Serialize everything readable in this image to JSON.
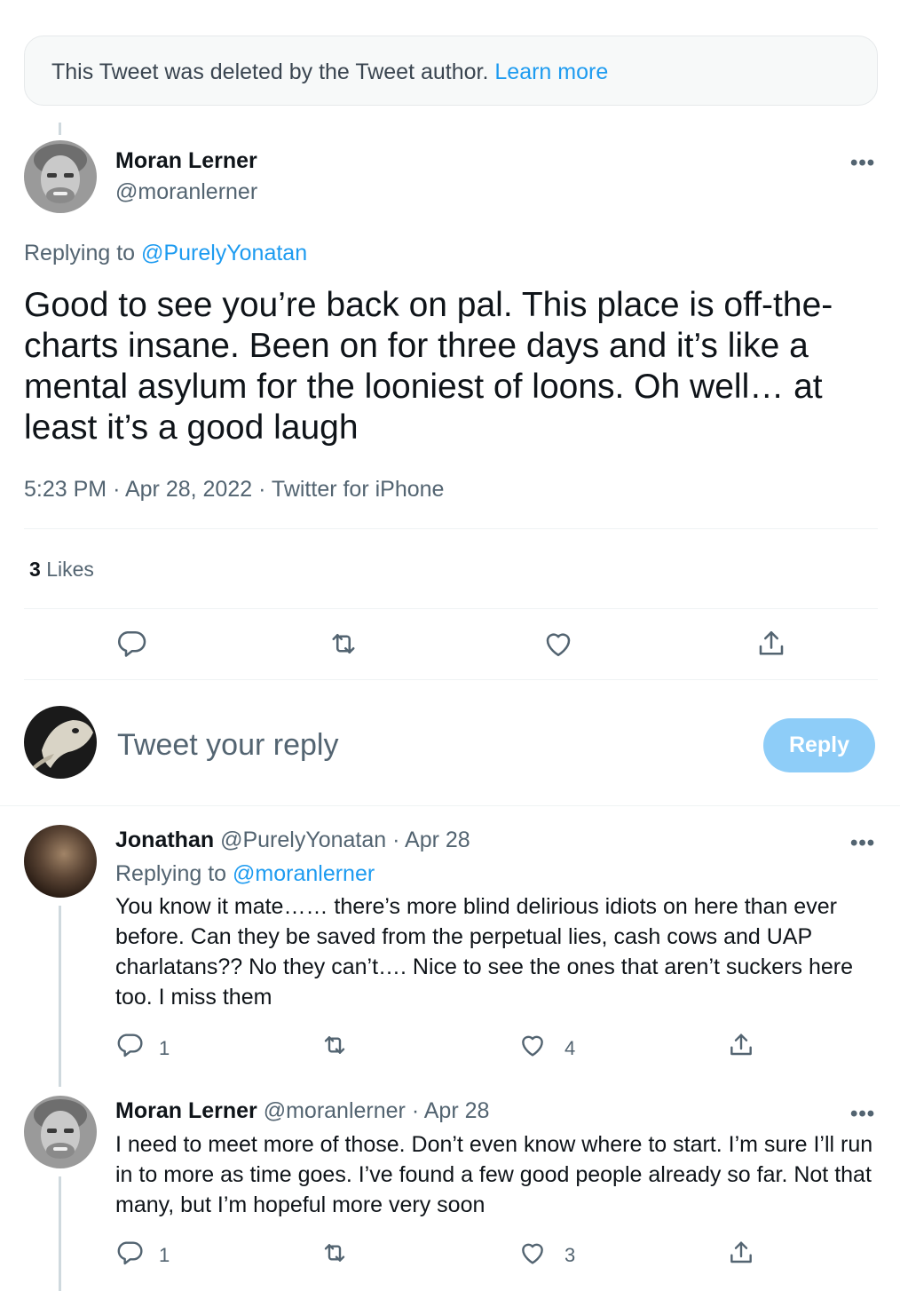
{
  "deleted_notice": {
    "text": "This Tweet was deleted by the Tweet author.",
    "link": "Learn more"
  },
  "main_tweet": {
    "name": "Moran Lerner",
    "handle": "@moranlerner",
    "replying_prefix": "Replying to",
    "replying_to": "@PurelyYonatan",
    "text": "Good to see you’re back on pal. This place is off-the-charts insane. Been on for three days and it’s like a mental asylum for the looniest of loons. Oh well… at least it’s a good laugh",
    "time": "5:23 PM",
    "date": "Apr 28, 2022",
    "source": "Twitter for iPhone",
    "sep": "·",
    "likes_count": "3",
    "likes_label": "Likes",
    "more": "•••"
  },
  "composer": {
    "placeholder": "Tweet your reply",
    "button": "Reply"
  },
  "replies": [
    {
      "name": "Jonathan",
      "handle": "@PurelyYonatan",
      "date": "Apr 28",
      "sep": "·",
      "replying_prefix": "Replying to",
      "replying_to": "@moranlerner",
      "text": "You know it mate…… there’s more blind delirious idiots on here than ever before.  Can they be saved from the perpetual lies, cash cows and UAP charlatans?? No they can’t…. Nice to see the ones that aren’t suckers here too. I miss them",
      "reply_count": "1",
      "retweet_count": "",
      "like_count": "4",
      "more": "•••"
    },
    {
      "name": "Moran Lerner",
      "handle": "@moranlerner",
      "date": "Apr 28",
      "sep": "·",
      "text": "I need to meet more of those. Don’t even know where to start. I’m sure I’ll run in to more as time goes. I’ve found a few good people already so far. Not that many, but I’m hopeful more very soon",
      "reply_count": "1",
      "retweet_count": "",
      "like_count": "3",
      "more": "•••"
    }
  ],
  "icons": {
    "reply": "reply-icon",
    "retweet": "retweet-icon",
    "like": "heart-icon",
    "share": "share-icon",
    "more": "more-icon"
  },
  "colors": {
    "accent": "#1d9bf0",
    "muted": "#536471",
    "reply_button_disabled": "#8ecdf8"
  }
}
